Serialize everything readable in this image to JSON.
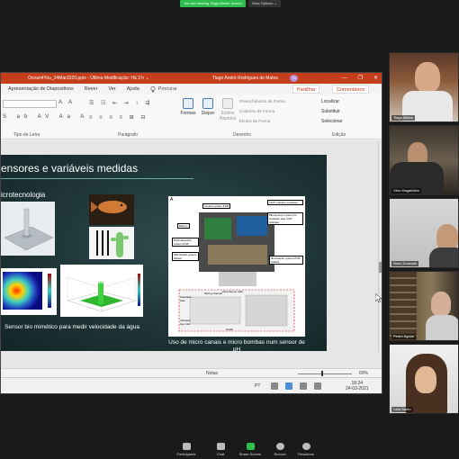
{
  "zoom": {
    "viewing_banner": "You are viewing Tiago Matos' screen",
    "view_options": "View Options ⌄",
    "controls": [
      {
        "label": "Participants",
        "icon": "participants-icon"
      },
      {
        "label": "Chat",
        "icon": "chat-icon"
      },
      {
        "label": "Share Screen",
        "icon": "share-screen-icon"
      },
      {
        "label": "Record",
        "icon": "record-icon"
      },
      {
        "label": "Reactions",
        "icon": "reactions-icon"
      }
    ],
    "participants": [
      {
        "name": "Tiago Matos"
      },
      {
        "name": "Vitor Magalhães"
      },
      {
        "name": "Nuno Dourado"
      },
      {
        "name": "Pedro Aguiar"
      },
      {
        "name": "Lara Santo"
      }
    ]
  },
  "ppt": {
    "document_title": "Ocean4You_24Mar2020.pptx  -  Última Modificação: Há 3 h  ⌄",
    "user_name": "Tiago André Rodrigues de Matos",
    "user_initials": "TA",
    "window_controls": [
      "—",
      "❐",
      "✕"
    ],
    "tabs": [
      "Apresentação de Diapositivos",
      "Rever",
      "Ver",
      "Ajuda"
    ],
    "search_label": "Procurar",
    "share_label": "Partilhar",
    "comments_label": "Comentários",
    "ribbon": {
      "font_group": "Tipo de Letra",
      "paragraph_group": "Parágrafo",
      "drawing_group": "Desenho",
      "editing_group": "Edição",
      "shapes_label": "Formas",
      "arrange_label": "Dispor",
      "quick_styles_label": "Estilos Rápidos",
      "shape_fill": "Preenchimento de Forma",
      "shape_outline": "Contorno de Forma",
      "shape_effects": "Efeitos de Forma",
      "find": "Localizar",
      "replace": "Substituir",
      "select": "Selecionar"
    },
    "slide": {
      "title": "ensores e variáveis medidas",
      "subtitle": "icrotecnologia",
      "caption_left": "Sensor bio mimético para medir velocidade da água",
      "caption_right": "Uso de micro canais e micro bombas num sensor de pH",
      "figure_label": "A",
      "sensor_labels": [
        "Control system PCB",
        "mCP indicator container",
        "Micropumps system for seawater and mCP indicator",
        "Battery",
        "Photodetection system PCB",
        "Microfluidic system drawer",
        "Illumination system PCB (LEDs)",
        "Absorbance cells",
        "Mixing channel",
        "Seawater inlet",
        "Indicator dye inlet",
        "Outlet"
      ]
    },
    "status": {
      "notes": "Notas",
      "zoom": "69%"
    },
    "taskbar": {
      "language": "PT",
      "time": "18:24",
      "date": "24-03-2021"
    }
  }
}
